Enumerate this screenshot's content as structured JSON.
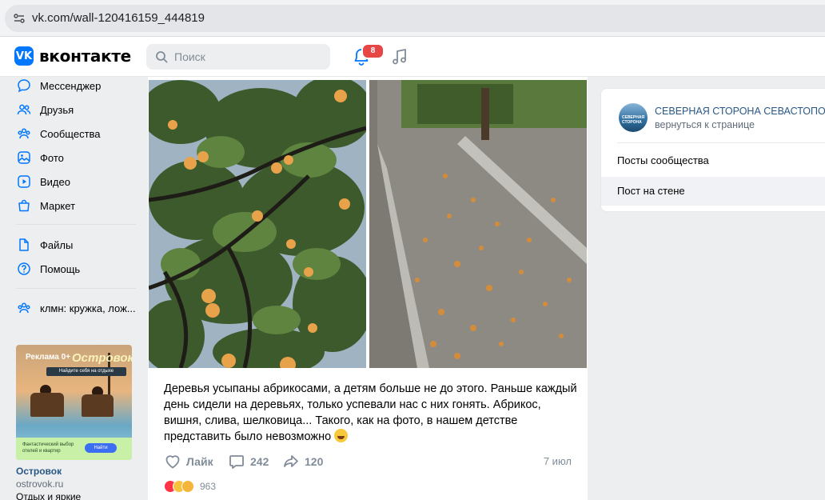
{
  "browser": {
    "url": "vk.com/wall-120416159_444819"
  },
  "header": {
    "logo_text": "вконтакте",
    "search_placeholder": "Поиск",
    "notifications_count": "8"
  },
  "sidebar": {
    "items": [
      {
        "label": "Мессенджер",
        "icon": "message-icon"
      },
      {
        "label": "Друзья",
        "icon": "friends-icon"
      },
      {
        "label": "Сообщества",
        "icon": "communities-icon"
      },
      {
        "label": "Фото",
        "icon": "photo-icon"
      },
      {
        "label": "Видео",
        "icon": "video-icon"
      },
      {
        "label": "Маркет",
        "icon": "market-icon"
      },
      {
        "label": "Файлы",
        "icon": "files-icon"
      },
      {
        "label": "Помощь",
        "icon": "help-icon"
      },
      {
        "label": "клмн: кружка, лож...",
        "icon": "group-chat-icon"
      }
    ]
  },
  "ad": {
    "label": "Реклама 0+",
    "brand": "Островок!",
    "tagline": "Найдите себя на отдыхе",
    "bottom_text": "Фантастический выбор отелей и квартир",
    "button": "Найти",
    "name": "Островок",
    "domain": "ostrovok.ru",
    "more": "Отдых и яркие"
  },
  "post": {
    "text": "Деревья усыпаны абрикосами, а детям больше не до этого. Раньше каждый день сидели на деревьях, только успевали нас с них гонять. Абрикос, вишня, слива, шелковица... Такого, как на фото, в нашем детстве представить было невозможно",
    "like_label": "Лайк",
    "comments": "242",
    "shares": "120",
    "date": "7 июл",
    "reactions_count": "963"
  },
  "right_panel": {
    "group_name": "СЕВЕРНАЯ СТОРОНА СЕВАСТОПОЛЬ",
    "back_label": "вернуться к странице",
    "avatar_text": "СЕВЕРНАЯ СТОРОНА",
    "items": [
      {
        "label": "Посты сообщества",
        "active": false
      },
      {
        "label": "Пост на стене",
        "active": true
      }
    ]
  },
  "colors": {
    "accent": "#0077ff",
    "link": "#2a5885",
    "badge": "#e64646"
  }
}
